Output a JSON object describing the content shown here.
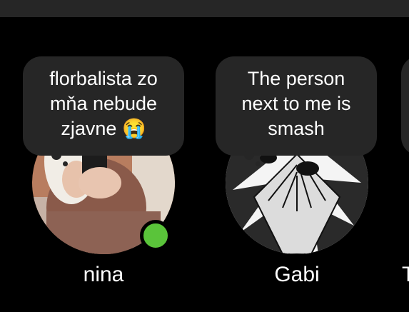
{
  "stories": [
    {
      "name": "nina",
      "note_lines": [
        "florbalista zo",
        "mňa nebude",
        "zjavne 😭"
      ],
      "online": true
    },
    {
      "name": "Gabi",
      "note_lines": [
        "The person",
        "next to me is",
        "smash"
      ],
      "online": false
    }
  ],
  "partial_next_name": "T",
  "colors": {
    "background": "#000000",
    "note_bubble": "#262626",
    "online_dot": "#5ac43a"
  }
}
